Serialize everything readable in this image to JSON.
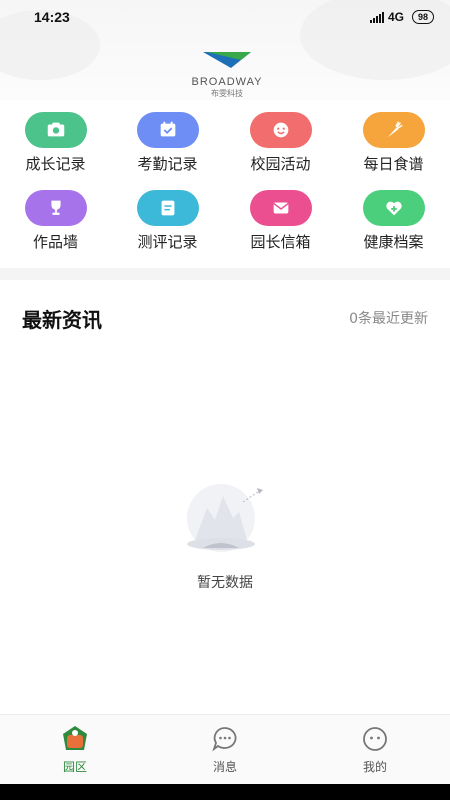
{
  "status_bar": {
    "time": "14:23",
    "network": "4G",
    "battery": "98"
  },
  "logo": {
    "wordmark": "BROADWAY",
    "subtitle": "布雯科技"
  },
  "features": [
    {
      "label": "成长记录",
      "icon": "camera-icon",
      "color": "#4cc38a"
    },
    {
      "label": "考勤记录",
      "icon": "calendar-check-icon",
      "color": "#6e8ef6"
    },
    {
      "label": "校园活动",
      "icon": "smiley-icon",
      "color": "#f26d6d"
    },
    {
      "label": "每日食谱",
      "icon": "carrot-icon",
      "color": "#f5a53b"
    },
    {
      "label": "作品墙",
      "icon": "trophy-icon",
      "color": "#a673ea"
    },
    {
      "label": "测评记录",
      "icon": "document-icon",
      "color": "#3cb8d8"
    },
    {
      "label": "园长信箱",
      "icon": "mail-icon",
      "color": "#ec4f8f"
    },
    {
      "label": "健康档案",
      "icon": "heart-plus-icon",
      "color": "#4ccf7c"
    }
  ],
  "news": {
    "title": "最新资讯",
    "count_text": "0条最近更新",
    "empty_text": "暂无数据"
  },
  "tabbar": {
    "items": [
      {
        "label": "园区",
        "icon": "campus-icon",
        "active": true
      },
      {
        "label": "消息",
        "icon": "chat-bubble-icon",
        "active": false
      },
      {
        "label": "我的",
        "icon": "profile-face-icon",
        "active": false
      }
    ],
    "active_color": "#2f8a3e"
  }
}
